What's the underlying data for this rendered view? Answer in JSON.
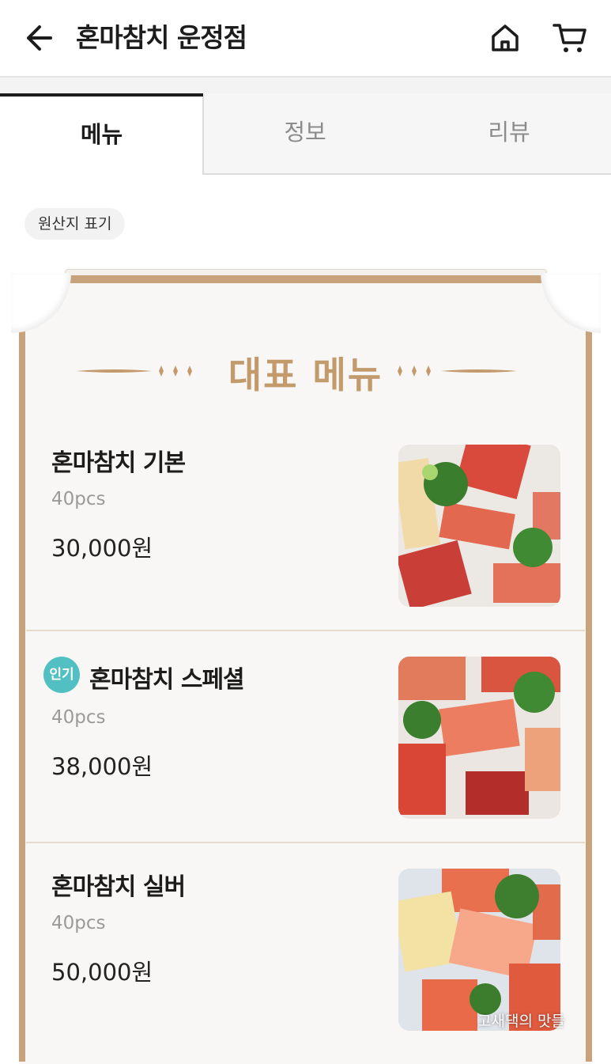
{
  "header": {
    "title": "혼마참치 운정점",
    "back_icon": "arrow-left-icon",
    "home_icon": "home-icon",
    "cart_icon": "cart-icon"
  },
  "tabs": [
    {
      "label": "메뉴",
      "active": true
    },
    {
      "label": "정보",
      "active": false
    },
    {
      "label": "리뷰",
      "active": false
    }
  ],
  "origin_chip": "원산지 표기",
  "section": {
    "title": "대표 메뉴",
    "accent_color": "#c29a6c"
  },
  "menu": [
    {
      "name": "혼마참치 기본",
      "desc": "40pcs",
      "price": "30,000원",
      "badge": ""
    },
    {
      "name": "혼마참치 스페셜",
      "desc": "40pcs",
      "price": "38,000원",
      "badge": "인기"
    },
    {
      "name": "혼마참치 실버",
      "desc": "40pcs",
      "price": "50,000원",
      "badge": ""
    }
  ],
  "watermark": "고새댁의 맛들"
}
